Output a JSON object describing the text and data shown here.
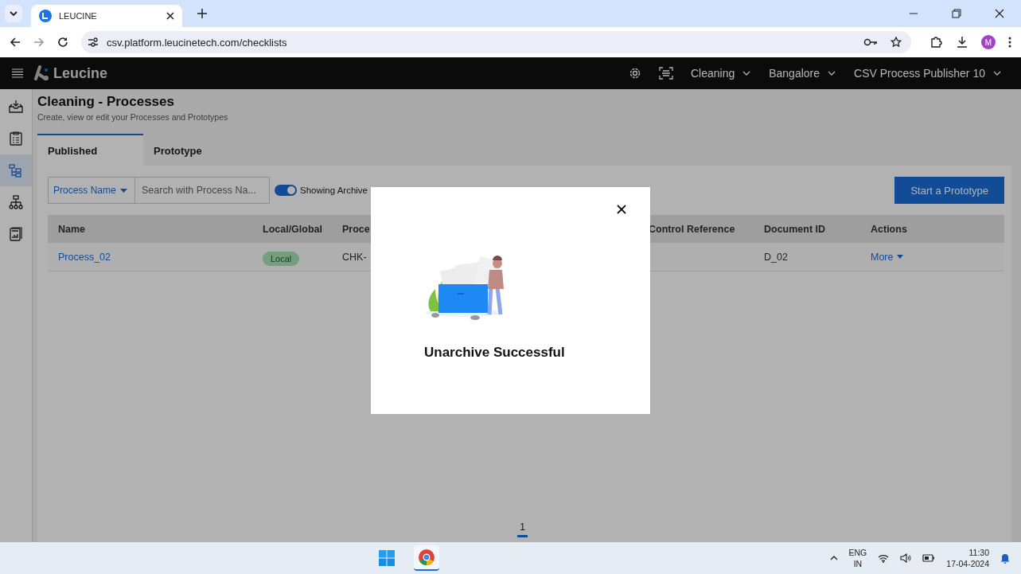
{
  "browser": {
    "tabs": [
      {
        "title": "LEUCINE",
        "selected": true
      }
    ],
    "url": "csv.platform.leucinetech.com/checklists",
    "profile_initial": "M"
  },
  "header": {
    "brand": "Leucine",
    "menus": [
      {
        "label": "Cleaning"
      },
      {
        "label": "Bangalore"
      },
      {
        "label": "CSV Process Publisher 10"
      }
    ]
  },
  "sidebar": {
    "items": [
      {
        "selected": false
      },
      {
        "selected": false
      },
      {
        "selected": true
      },
      {
        "selected": false
      },
      {
        "selected": false
      }
    ]
  },
  "page": {
    "title": "Cleaning - Processes",
    "subtitle": "Create, view or edit your Processes and Prototypes"
  },
  "tabs": [
    {
      "label": "Published",
      "selected": true
    },
    {
      "label": "Prototype",
      "selected": false
    }
  ],
  "filters": {
    "dropdown": "Process Name",
    "search": {
      "placeholder": "Search with Process Na..."
    },
    "toggle": {
      "label": "Showing Archive",
      "on": true
    }
  },
  "primary_button": "Start a Prototype",
  "table": {
    "columns": [
      "Name",
      "Local/Global",
      "Proce",
      "Control Reference",
      "Document ID",
      "Actions"
    ],
    "rows": [
      {
        "name": "Process_02",
        "scope": "Local",
        "column_3": "CHK-",
        "document_id": "D_02",
        "action": "More"
      }
    ]
  },
  "pagination": [
    {
      "label": "1",
      "selected": true
    }
  ],
  "modal": {
    "message": "Unarchive Successful"
  },
  "taskbar": {
    "language": "ENG",
    "region": "IN",
    "time": "11:30",
    "date": "17-04-2024"
  }
}
